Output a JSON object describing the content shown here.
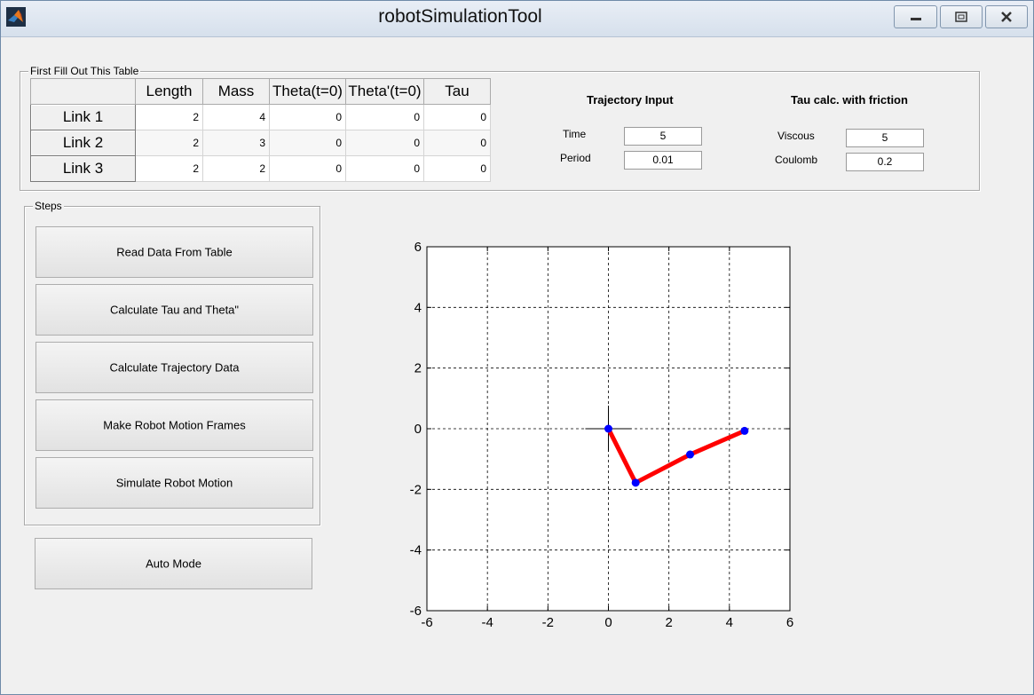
{
  "window": {
    "title": "robotSimulationTool"
  },
  "table_group": {
    "label": "First Fill Out This Table",
    "columns": [
      "Length",
      "Mass",
      "Theta(t=0)",
      "Theta'(t=0)",
      "Tau"
    ],
    "rows": [
      {
        "name": "Link 1",
        "values": [
          "2",
          "4",
          "0",
          "0",
          "0"
        ]
      },
      {
        "name": "Link 2",
        "values": [
          "2",
          "3",
          "0",
          "0",
          "0"
        ]
      },
      {
        "name": "Link 3",
        "values": [
          "2",
          "2",
          "0",
          "0",
          "0"
        ]
      }
    ]
  },
  "trajectory": {
    "heading": "Trajectory Input",
    "time_label": "Time",
    "time_value": "5",
    "period_label": "Period",
    "period_value": "0.01"
  },
  "friction": {
    "heading": "Tau calc. with friction",
    "viscous_label": "Viscous",
    "viscous_value": "5",
    "coulomb_label": "Coulomb",
    "coulomb_value": "0.2"
  },
  "steps": {
    "label": "Steps",
    "buttons": [
      "Read Data From Table",
      "Calculate Tau and Theta\"",
      "Calculate Trajectory Data",
      "Make Robot Motion Frames",
      "Simulate Robot Motion"
    ]
  },
  "auto_mode_label": "Auto Mode",
  "colors": {
    "link_line": "#ff0000",
    "joint_marker": "#0000ff"
  },
  "chart_data": {
    "type": "line",
    "title": "",
    "xlabel": "",
    "ylabel": "",
    "xlim": [
      -6,
      6
    ],
    "ylim": [
      -6,
      6
    ],
    "xticks": [
      -6,
      -4,
      -2,
      0,
      2,
      4,
      6
    ],
    "yticks": [
      -6,
      -4,
      -2,
      0,
      2,
      4,
      6
    ],
    "grid": true,
    "series": [
      {
        "points": [
          [
            0,
            0
          ],
          [
            0.9,
            -1.78
          ],
          [
            2.7,
            -0.85
          ],
          [
            4.5,
            -0.07
          ]
        ]
      }
    ]
  }
}
